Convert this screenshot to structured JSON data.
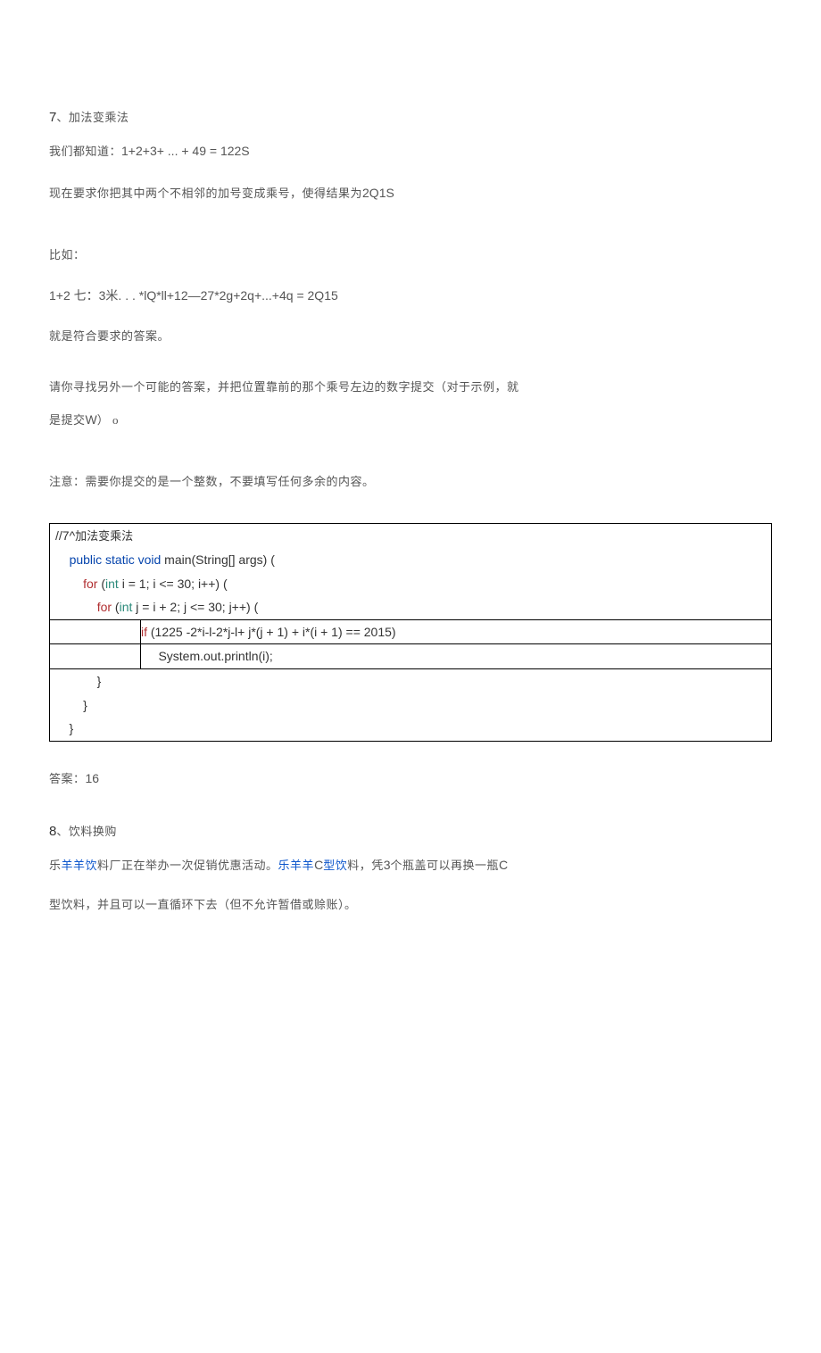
{
  "q7": {
    "title_num": "7",
    "title_text": "、加法变乘法",
    "p1_a": "我们都知道：",
    "p1_b": "1+2+3+ ... + 49 = 122S",
    "p2_a": "现在要求你把其中两个不相邻的加号变成乘号，使得结果为",
    "p2_b": "2Q1S",
    "p3": "比如：",
    "p4": "1+2 七：3米. . . *lQ*ll+12—27*2g+2q+...+4q = 2Q15",
    "p5": "就是符合要求的答案。",
    "p6": "请你寻找另外一个可能的答案，并把位置靠前的那个乘号左边的数字提交（对于示例，就",
    "p7_a": "是提交",
    "p7_b": "W",
    "p7_c": "） o",
    "p8": "注意：需要你提交的是一个整数，不要填写任何多余的内容。"
  },
  "code": {
    "l1_a": "//7^",
    "l1_b": "加法变乘法",
    "l2_a": "    ",
    "l2_b": "public static void",
    "l2_c": " main(String[] args) (",
    "l3_a": "        ",
    "l3_b": "for",
    "l3_c": " (",
    "l3_d": "int",
    "l3_e": " i = 1; i <= 30; i++) (",
    "l4_a": "            ",
    "l4_b": "for",
    "l4_c": " (",
    "l4_d": "int",
    "l4_e": " j = i + 2; j <= 30; j++) (",
    "l5_left": "                ",
    "l5_b": "if",
    "l5_c": " (1225 -2*i-l-2*j-l+ j*(j + 1) + i*(i + 1) == 2015)",
    "l6_left": "                ",
    "l6_right": "     System.out.println(i);",
    "l7": "            }",
    "l8": "        }",
    "l9": "    }"
  },
  "ans": {
    "label": "答案：",
    "value": "16"
  },
  "q8": {
    "title_num": "8",
    "title_text": "、饮料换购",
    "p1_a": "乐",
    "p1_b": "羊羊饮",
    "p1_c": "料厂正在举办一次促销优惠活动。",
    "p1_d": "乐羊羊",
    "p1_e": "C",
    "p1_f": "型饮",
    "p1_g": "料，凭",
    "p1_h": "3",
    "p1_i": "个瓶盖可以再换一瓶",
    "p1_j": "C",
    "p2": "型饮料，并且可以一直循环下去（但不允许暂借或赊账）。"
  }
}
